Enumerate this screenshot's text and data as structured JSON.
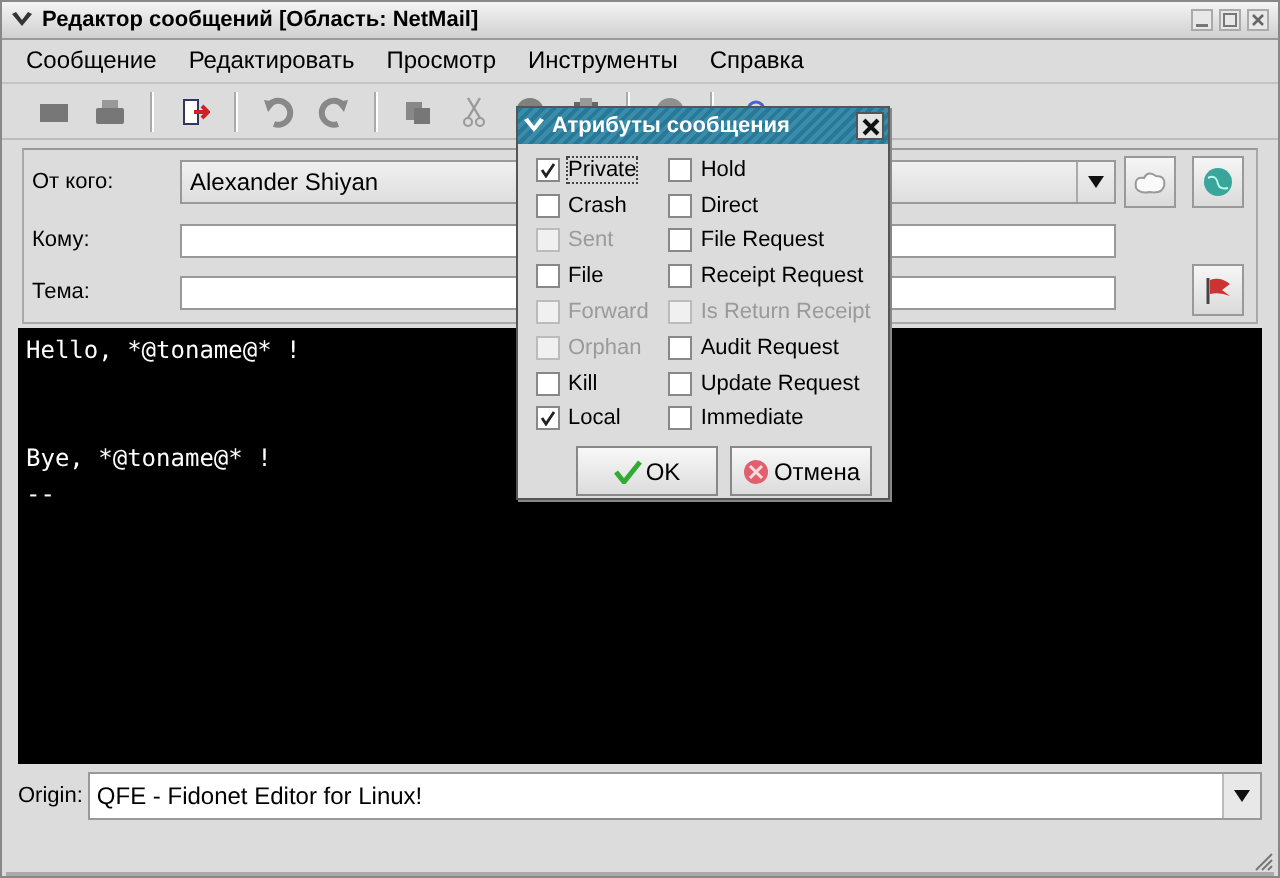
{
  "window": {
    "title": "Редактор сообщений [Область: NetMail]"
  },
  "menu": [
    "Сообщение",
    "Редактировать",
    "Просмотр",
    "Инструменты",
    "Справка"
  ],
  "header": {
    "fields": [
      {
        "label": "От кого:",
        "value": "Alexander Shiyan",
        "kind": "combo"
      },
      {
        "label": "Кому:",
        "kind": "text"
      },
      {
        "label": "Тема:",
        "kind": "text"
      }
    ]
  },
  "editor": {
    "blocks": [
      {
        "lines": [
          "Hello, *@toname@* !"
        ]
      },
      {
        "lines": [
          "Bye, *@toname@* !",
          "--"
        ]
      }
    ]
  },
  "origin": {
    "label": "Origin:",
    "value": "QFE - Fidonet Editor for Linux!"
  },
  "dialog": {
    "title": "Атрибуты сообщения",
    "columns": [
      [
        {
          "label": "Private",
          "checked": true,
          "disabled": false,
          "focused": true
        },
        {
          "label": "Crash",
          "checked": false,
          "disabled": false,
          "focused": false
        },
        {
          "label": "Sent",
          "checked": false,
          "disabled": true,
          "focused": false
        },
        {
          "label": "File",
          "checked": false,
          "disabled": false,
          "focused": false
        },
        {
          "label": "Forward",
          "checked": false,
          "disabled": true,
          "focused": false
        },
        {
          "label": "Orphan",
          "checked": false,
          "disabled": true,
          "focused": false
        },
        {
          "label": "Kill",
          "checked": false,
          "disabled": false,
          "focused": false
        },
        {
          "label": "Local",
          "checked": true,
          "disabled": false,
          "focused": false
        }
      ],
      [
        {
          "label": "Hold",
          "checked": false,
          "disabled": false,
          "focused": false
        },
        {
          "label": "Direct",
          "checked": false,
          "disabled": false,
          "focused": false
        },
        {
          "label": "File Request",
          "checked": false,
          "disabled": false,
          "focused": false
        },
        {
          "label": "Receipt Request",
          "checked": false,
          "disabled": false,
          "focused": false
        },
        {
          "label": "Is Return Receipt",
          "checked": false,
          "disabled": true,
          "focused": false
        },
        {
          "label": "Audit Request",
          "checked": false,
          "disabled": false,
          "focused": false
        },
        {
          "label": "Update Request",
          "checked": false,
          "disabled": false,
          "focused": false
        },
        {
          "label": "Immediate",
          "checked": false,
          "disabled": false,
          "focused": false
        }
      ]
    ],
    "buttons": [
      {
        "label": "OK",
        "kind": "ok"
      },
      {
        "label": "Отмена",
        "kind": "cancel"
      }
    ]
  }
}
